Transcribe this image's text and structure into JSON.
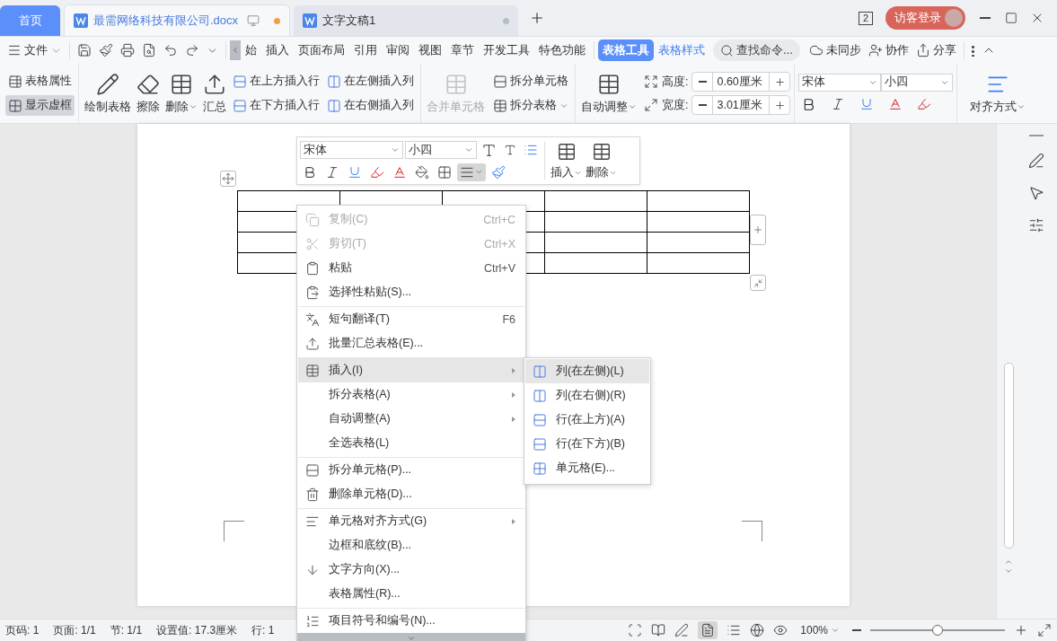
{
  "tabs": [
    {
      "label": "首页",
      "kind": "home",
      "selected": false
    },
    {
      "label": "最需网络科技有限公司.docx",
      "kind": "doc",
      "selected": true,
      "modified": true
    },
    {
      "label": "文字文稿1",
      "kind": "doc",
      "selected": false,
      "modified": false
    }
  ],
  "title_bar": {
    "window_count": "2",
    "login": "访客登录"
  },
  "menu_bar": {
    "file": "文件",
    "tabs": [
      {
        "label": "始",
        "selected": false,
        "contextual": false
      },
      {
        "label": "插入",
        "selected": false,
        "contextual": false
      },
      {
        "label": "页面布局",
        "selected": false,
        "contextual": false
      },
      {
        "label": "引用",
        "selected": false,
        "contextual": false
      },
      {
        "label": "审阅",
        "selected": false,
        "contextual": false
      },
      {
        "label": "视图",
        "selected": false,
        "contextual": false
      },
      {
        "label": "章节",
        "selected": false,
        "contextual": false
      },
      {
        "label": "开发工具",
        "selected": false,
        "contextual": false
      },
      {
        "label": "特色功能",
        "selected": false,
        "contextual": false
      },
      {
        "label": "表格工具",
        "selected": true,
        "contextual": true
      },
      {
        "label": "表格样式",
        "selected": false,
        "contextual": true
      }
    ],
    "search": {
      "placeholder": "查找命令..."
    },
    "actions": [
      "未同步",
      "协作",
      "分享"
    ]
  },
  "ribbon": {
    "properties": "表格属性",
    "gridlines": {
      "label": "显示虚框",
      "on": true
    },
    "big_tools": [
      {
        "label": "绘制表格",
        "dropdown": false
      },
      {
        "label": "擦除",
        "dropdown": false
      },
      {
        "label": "删除",
        "dropdown": true
      },
      {
        "label": "汇总",
        "dropdown": false
      }
    ],
    "insert_rows": [
      "在上方插入行",
      "在下方插入行"
    ],
    "insert_cols": [
      "在左侧插入列",
      "在右侧插入列"
    ],
    "merge": {
      "label": "合并单元格",
      "disabled": true
    },
    "split_cell": "拆分单元格",
    "split_table": "拆分表格",
    "autofit": "自动调整",
    "height": {
      "label": "高度:",
      "value": "0.60厘米"
    },
    "width": {
      "label": "宽度:",
      "value": "3.01厘米"
    },
    "font": "宋体",
    "size": "小四",
    "align": "对齐方式"
  },
  "float_toolbar": {
    "font": "宋体",
    "size": "小四",
    "align_active": true,
    "insert": "插入",
    "delete": "删除"
  },
  "context_menu": [
    {
      "label": "复制(C)",
      "shortcut": "Ctrl+C",
      "disabled": true,
      "submenu": false,
      "selected": false,
      "divider": false
    },
    {
      "label": "剪切(T)",
      "shortcut": "Ctrl+X",
      "disabled": true,
      "submenu": false,
      "selected": false,
      "divider": false
    },
    {
      "label": "粘贴",
      "shortcut": "Ctrl+V",
      "disabled": false,
      "submenu": false,
      "selected": false,
      "divider": false
    },
    {
      "label": "选择性粘贴(S)...",
      "disabled": false,
      "submenu": false,
      "selected": false,
      "divider": false
    },
    {
      "label": "短句翻译(T)",
      "shortcut": "F6",
      "disabled": false,
      "submenu": false,
      "selected": false,
      "divider": true
    },
    {
      "label": "批量汇总表格(E)...",
      "disabled": false,
      "submenu": false,
      "selected": false,
      "divider": false
    },
    {
      "label": "插入(I)",
      "disabled": false,
      "submenu": true,
      "selected": true,
      "divider": true
    },
    {
      "label": "拆分表格(A)",
      "disabled": false,
      "submenu": true,
      "selected": false,
      "divider": false
    },
    {
      "label": "自动调整(A)",
      "disabled": false,
      "submenu": true,
      "selected": false,
      "divider": false
    },
    {
      "label": "全选表格(L)",
      "disabled": false,
      "submenu": false,
      "selected": false,
      "divider": false
    },
    {
      "label": "拆分单元格(P)...",
      "disabled": false,
      "submenu": false,
      "selected": false,
      "divider": true
    },
    {
      "label": "删除单元格(D)...",
      "disabled": false,
      "submenu": false,
      "selected": false,
      "divider": false
    },
    {
      "label": "单元格对齐方式(G)",
      "disabled": false,
      "submenu": true,
      "selected": false,
      "divider": true
    },
    {
      "label": "边框和底纹(B)...",
      "disabled": false,
      "submenu": false,
      "selected": false,
      "divider": false
    },
    {
      "label": "文字方向(X)...",
      "disabled": false,
      "submenu": false,
      "selected": false,
      "divider": false
    },
    {
      "label": "表格属性(R)...",
      "disabled": false,
      "submenu": false,
      "selected": false,
      "divider": false
    },
    {
      "label": "项目符号和编号(N)...",
      "disabled": false,
      "submenu": false,
      "selected": false,
      "divider": true
    }
  ],
  "submenu": [
    {
      "label": "列(在左侧)(L)",
      "selected": true
    },
    {
      "label": "列(在右侧)(R)",
      "selected": false
    },
    {
      "label": "行(在上方)(A)",
      "selected": false
    },
    {
      "label": "行(在下方)(B)",
      "selected": false
    },
    {
      "label": "单元格(E)...",
      "selected": false
    }
  ],
  "status_bar": {
    "items": [
      "页码: 1",
      "页面: 1/1",
      "节: 1/1",
      "设置值: 17.3厘米",
      "行: 1"
    ],
    "zoom": "100%",
    "zoom_slider": {
      "level": 0.5
    }
  }
}
